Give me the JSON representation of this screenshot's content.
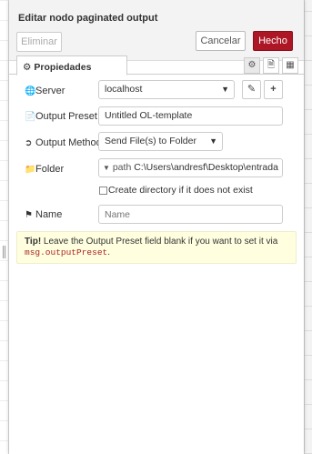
{
  "dialog": {
    "title": "Editar nodo paginated output",
    "delete_label": "Eliminar",
    "cancel_label": "Cancelar",
    "done_label": "Hecho",
    "done_color": "#ad1625"
  },
  "tabs": {
    "properties_label": "Propiedades",
    "properties_icon": "gear-icon",
    "buttons": [
      "gear-icon",
      "document-icon",
      "layout-icon"
    ]
  },
  "form": {
    "server": {
      "label": "Server",
      "icon": "globe-icon",
      "value": "localhost"
    },
    "output_preset": {
      "label": "Output Preset",
      "icon": "file-icon",
      "value": "Untitled OL-template"
    },
    "output_method": {
      "label": "Output Method",
      "icon": "sign-out-icon",
      "value": "Send File(s) to Folder"
    },
    "folder": {
      "label": "Folder",
      "icon": "folder-icon",
      "type": "path",
      "value": "C:\\Users\\andresf\\Desktop\\entrada"
    },
    "create_directory": {
      "label": "Create directory if it does not exist",
      "checked": false
    },
    "name": {
      "label": "Name",
      "icon": "tag-icon",
      "placeholder": "Name"
    }
  },
  "tip": {
    "strong": "Tip!",
    "text": " Leave the Output Preset field blank if you want to set it via",
    "code": "msg.outputPreset",
    "end": "."
  }
}
